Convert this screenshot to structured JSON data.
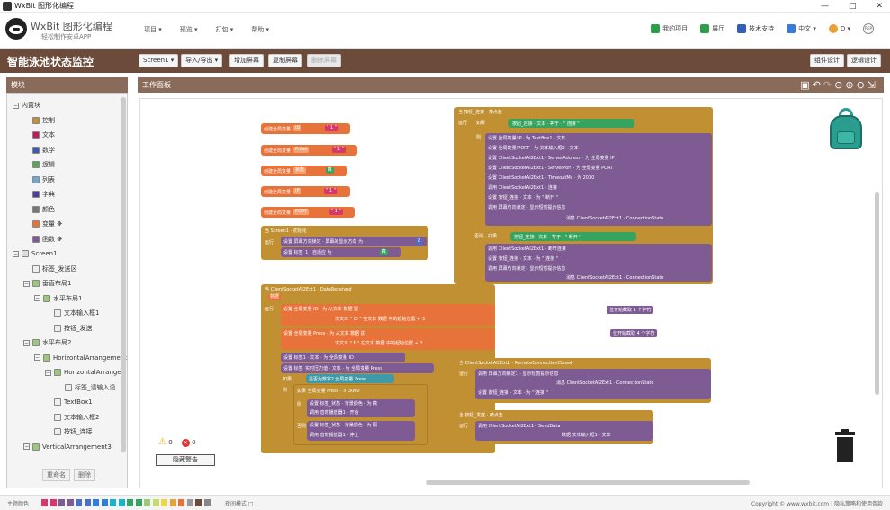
{
  "window": {
    "title": "WxBit 图形化编程",
    "minimize": "—",
    "maximize": "□",
    "close": "✕"
  },
  "header": {
    "brand": "WxBit 图形化编程",
    "subtitle": "轻松制作安卓APP",
    "menu": [
      "项目 ▾",
      "预览 ▾",
      "打包 ▾",
      "帮助 ▾"
    ],
    "right": [
      {
        "label": "我的项目",
        "color": "#2e9e4a",
        "icon": "folder-icon"
      },
      {
        "label": "展厅",
        "color": "#2e9e4a",
        "icon": "gallery-icon"
      },
      {
        "label": "技术支持",
        "color": "#2f5fb8",
        "icon": "support-icon"
      },
      {
        "label": "中文 ▾",
        "color": "#3a7bd5",
        "icon": "language-icon"
      },
      {
        "label": "D ▾",
        "color": "#e8a23a",
        "icon": "user-icon"
      },
      {
        "label": "REP",
        "color": "#888888",
        "icon": "report-icon"
      }
    ]
  },
  "toolbar": {
    "project_title": "智能泳池状态监控",
    "screen_select": "Screen1 ▾",
    "import_export": "导入/导出 ▾",
    "add_screen": "增加屏幕",
    "copy_screen": "复制屏幕",
    "delete_screen": "删除屏幕",
    "designer": "组件设计",
    "logic": "逻辑设计"
  },
  "panels": {
    "blocks_title": "模块",
    "canvas_title": "工作面板"
  },
  "tree": [
    {
      "label": "内置块",
      "indent": 0,
      "toggle": "−",
      "color": ""
    },
    {
      "label": "控制",
      "indent": 1,
      "toggle": "",
      "color": "#c19032"
    },
    {
      "label": "文本",
      "indent": 1,
      "toggle": "",
      "color": "#c2185b"
    },
    {
      "label": "数学",
      "indent": 1,
      "toggle": "",
      "color": "#3f5aa8"
    },
    {
      "label": "逻辑",
      "indent": 1,
      "toggle": "",
      "color": "#5ba35b"
    },
    {
      "label": "列表",
      "indent": 1,
      "toggle": "",
      "color": "#6aa8d8"
    },
    {
      "label": "字典",
      "indent": 1,
      "toggle": "",
      "color": "#4b3f9a"
    },
    {
      "label": "颜色",
      "indent": 1,
      "toggle": "",
      "color": "#777777"
    },
    {
      "label": "变量 ✥",
      "indent": 1,
      "toggle": "",
      "color": "#e8733a"
    },
    {
      "label": "函数 ✥",
      "indent": 1,
      "toggle": "",
      "color": "#7f5b94"
    },
    {
      "label": "Screen1",
      "indent": 0,
      "toggle": "−",
      "color": "#dddddd"
    },
    {
      "label": "标签_发送区",
      "indent": 1,
      "toggle": "",
      "color": "#eeeeee"
    },
    {
      "label": "垂直布局1",
      "indent": 1,
      "toggle": "−",
      "color": "#9cc87a"
    },
    {
      "label": "水平布局1",
      "indent": 2,
      "toggle": "−",
      "color": "#9cc87a"
    },
    {
      "label": "文本输入框1",
      "indent": 3,
      "toggle": "",
      "color": "#eeeeee"
    },
    {
      "label": "按钮_发送",
      "indent": 3,
      "toggle": "",
      "color": "#eeeeee"
    },
    {
      "label": "水平布局2",
      "indent": 1,
      "toggle": "−",
      "color": "#9cc87a"
    },
    {
      "label": "HorizontalArrangement",
      "indent": 2,
      "toggle": "−",
      "color": "#9cc87a"
    },
    {
      "label": "HorizontalArrange",
      "indent": 3,
      "toggle": "−",
      "color": "#9cc87a"
    },
    {
      "label": "标签_请输入设",
      "indent": 4,
      "toggle": "",
      "color": "#eeeeee"
    },
    {
      "label": "TextBox1",
      "indent": 3,
      "toggle": "",
      "color": "#eeeeee"
    },
    {
      "label": "文本输入框2",
      "indent": 3,
      "toggle": "",
      "color": "#eeeeee"
    },
    {
      "label": "按钮_连接",
      "indent": 3,
      "toggle": "",
      "color": "#eeeeee"
    },
    {
      "label": "VerticalArrangement3",
      "indent": 1,
      "toggle": "−",
      "color": "#9cc87a"
    }
  ],
  "left_buttons": {
    "rename": "重命名",
    "delete": "删除"
  },
  "warnings": {
    "warn_count": "0",
    "error_count": "0",
    "hide": "隐藏警告"
  },
  "blocks": {
    "g1": "创建全局变量",
    "g1_name": "ID",
    "g1_val": "\" 1 \"",
    "g2": "创建全局变量",
    "g2_name": "Press",
    "g2_val": "\" 1 \"",
    "g3": "创建全局变量",
    "g3_name": "状态",
    "g3_val": "真",
    "g4": "创建全局变量",
    "g4_name": "IP",
    "g4_val": "\" 1 \"",
    "g5": "创建全局变量",
    "g5_name": "PORT",
    "g5_val": "\" 1 \"",
    "init": "当 Screen1 · 初始化",
    "init_do": "运行",
    "init_s1": "设置 屏幕方向锁定 · 屏幕的显示方向 为",
    "init_s1v": "2",
    "init_s2": "设置 标签_1 · 自适应 为",
    "init_s2v": "真",
    "click": "当 按钮_连接 · 被点击",
    "click_do": "运行",
    "click_if": "如果",
    "click_cond": "按钮_连接 · 文本 · 等于 · \" 连接 \"",
    "click_then": "则",
    "click_l1": "设置 全局变量 IP · 为 TextBox1 · 文本",
    "click_l2": "设置 全局变量 PORT · 为 文本输入框2 · 文本",
    "click_l3": "设置 ClientSocketAI2Ext1 · ServerAddress · 为 全局变量 IP",
    "click_l4": "设置 ClientSocketAI2Ext1 · ServerPort · 为 全局变量 PORT",
    "click_l5": "设置 ClientSocketAI2Ext1 · TimeoutMs · 为 2000",
    "click_l6": "调用 ClientSocketAI2Ext1 · 连接",
    "click_l7": "设置 按钮_连接 · 文本 · 为 \" 断开 \"",
    "click_l8": "调用 屏幕方向锁定 · 显示短暂提示信息",
    "click_l8m": "消息 ClientSocketAI2Ext1 · ConnectionState",
    "click_else": "否则，如果",
    "click_else_cond": "按钮_连接 · 文本 · 等于 · \" 断开 \"",
    "click_e1": "调用 ClientSocketAI2Ext1 · 断开连接",
    "click_e2": "设置 按钮_连接 · 文本 · 为 \" 连接 \"",
    "click_e3": "调用 屏幕方向锁定 · 显示短暂提示信息",
    "click_e3m": "消息 ClientSocketAI2Ext1 · ConnectionState",
    "recv": "当 ClientSocketAI2Ext1 · DataReceived",
    "recv_param": "数据",
    "recv_do": "运行",
    "recv_l1": "设置 全局变量 ID · 为 从文本 数据 提",
    "recv_l1b": "求文本 \" ID \" 在文本 数据 中的起始位置 + 3",
    "recv_l1c": "位开始截取 1 个字符",
    "recv_l2": "设置 全局变量 Press · 为 从文本 数据 提",
    "recv_l2b": "求文本 \" P \" 在文本 数据 中的起始位置 + 2",
    "recv_l2c": "位开始截取 4 个字符",
    "recv_l3": "设置 标签1 · 文本 · 为 全局变量 ID",
    "recv_l4": "设置 标签_实时压力值 · 文本 · 为 全局变量 Press",
    "recv_if": "如果",
    "recv_ifc": "是否为数字? 全局变量 Press",
    "recv_then": "则",
    "recv_if2": "如果 全局变量 Press · ≥ 3000",
    "recv_then2": "则",
    "recv_a1": "设置 标签_状态 · 背景颜色 · 为 真",
    "recv_a2": "调用 音效播放器1 · 开始",
    "recv_else": "否则",
    "recv_b1": "设置 标签_状态 · 背景颜色 · 为 假",
    "recv_b2": "调用 音效播放器1 · 停止",
    "remote": "当 ClientSocketAI2Ext1 · RemoteConnectionClosed",
    "remote_do": "运行",
    "remote_l1": "调用 屏幕方向锁定1 · 显示短暂提示信息",
    "remote_l1m": "消息 ClientSocketAI2Ext1 · ConnectionState",
    "remote_l2": "设置 按钮_连接 · 文本 · 为 \" 连接 \"",
    "send": "当 按钮_发送 · 被点击",
    "send_do": "运行",
    "send_l1": "调用 ClientSocketAI2Ext1 · SendData",
    "send_l1d": "数据 文本输入框1 · 文本"
  },
  "status": {
    "theme_label": "主题颜色",
    "night_mode": "夜间模式 □",
    "copyright": "Copyright © www.wxbit.com | 隐私策略和使用条款"
  },
  "colors": {
    "toolbar": "#6d4b3a",
    "panel_head": "#8a6a58",
    "variable": "#e8733a",
    "control": "#c19032",
    "component": "#7f5b94",
    "logic": "#36a35f"
  }
}
